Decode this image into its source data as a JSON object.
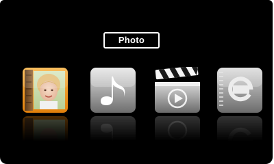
{
  "menu": {
    "selected_label": "Photo",
    "items": [
      {
        "id": "photo",
        "icon": "photo-album-icon",
        "selected": true
      },
      {
        "id": "music",
        "icon": "music-note-icon",
        "selected": false
      },
      {
        "id": "movie",
        "icon": "clapperboard-play-icon",
        "selected": false
      },
      {
        "id": "ebook",
        "icon": "ebook-icon",
        "selected": false
      }
    ]
  },
  "colors": {
    "background": "#000000",
    "selection_accent": "#f29a1e",
    "label_border": "#ffffff",
    "label_text": "#ffffff",
    "icon_silver": "#c9c9c9"
  }
}
